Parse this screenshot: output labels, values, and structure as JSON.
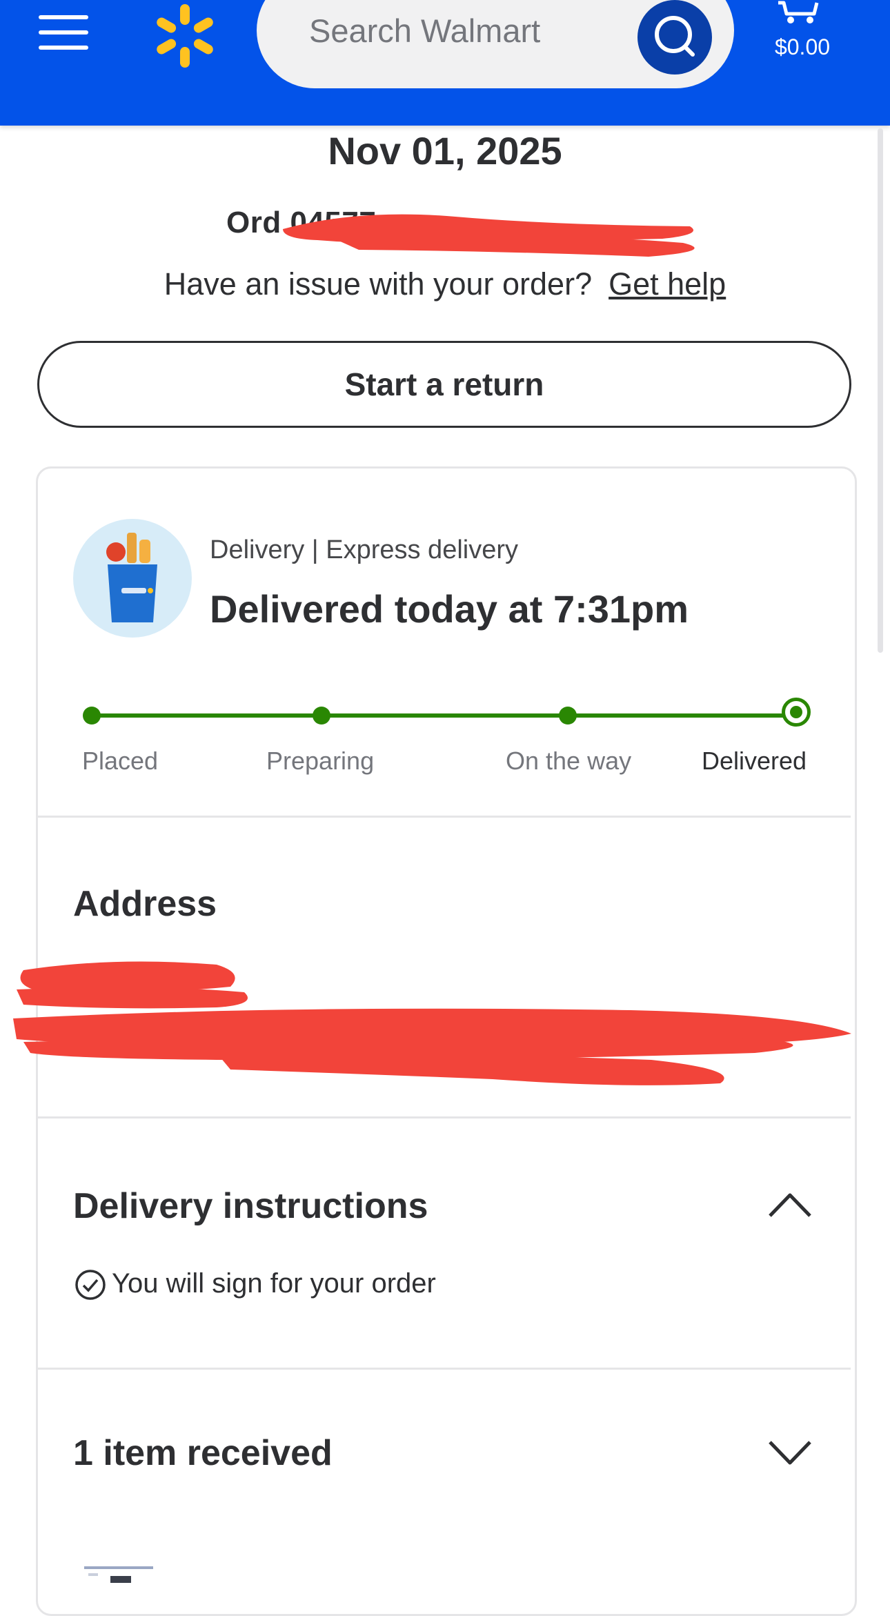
{
  "header": {
    "search_placeholder": "Search Walmart",
    "cart_total": "$0.00",
    "icons": {
      "menu": "hamburger-menu-icon",
      "logo": "walmart-spark-icon",
      "search": "search-icon",
      "cart": "cart-icon"
    }
  },
  "order": {
    "date": "Nov 01, 2025",
    "number_visible": "Ord 04577",
    "issue_text": "Have an issue with your order?",
    "help_link": "Get help",
    "return_button": "Start a return"
  },
  "delivery": {
    "type": "Delivery | Express delivery",
    "status": "Delivered today at 7:31pm",
    "steps": [
      "Placed",
      "Preparing",
      "On the way",
      "Delivered"
    ],
    "current_step": "Delivered",
    "progress": 1.0
  },
  "address": {
    "title": "Address"
  },
  "instructions": {
    "title": "Delivery instructions",
    "note": "You will sign for your order",
    "expanded": true
  },
  "items": {
    "title": "1 item received",
    "expanded": false
  },
  "colors": {
    "brand_blue": "#0353e9",
    "search_blue": "#0a3fa8",
    "spark_yellow": "#ffc220",
    "progress_green": "#2a8703",
    "redaction_red": "#f2443a"
  }
}
